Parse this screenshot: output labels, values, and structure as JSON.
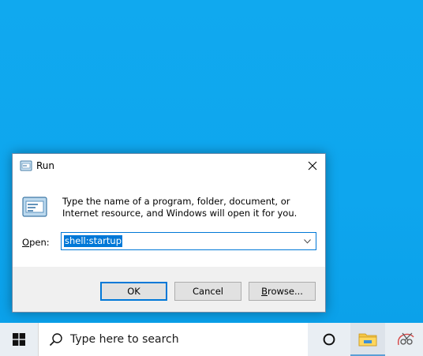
{
  "dialog": {
    "title": "Run",
    "description": "Type the name of a program, folder, document, or Internet resource, and Windows will open it for you.",
    "open_label_accel": "O",
    "open_label_rest": "pen:",
    "open_value": "shell:startup",
    "ok_label": "OK",
    "cancel_label": "Cancel",
    "browse_label_accel": "B",
    "browse_label_rest": "rowse...",
    "icons": {
      "title": "run-icon",
      "main": "run-icon",
      "close": "close-icon",
      "dropdown": "chevron-down-icon"
    }
  },
  "taskbar": {
    "search_placeholder": "Type here to search",
    "icons": {
      "start": "windows-logo-icon",
      "search": "search-icon",
      "cortana": "cortana-circle-icon",
      "explorer": "file-explorer-icon",
      "snip": "snip-sketch-icon"
    }
  },
  "colors": {
    "desktop": "#0fa8ee",
    "accent": "#0078d7",
    "taskbar": "#e9eef3"
  }
}
